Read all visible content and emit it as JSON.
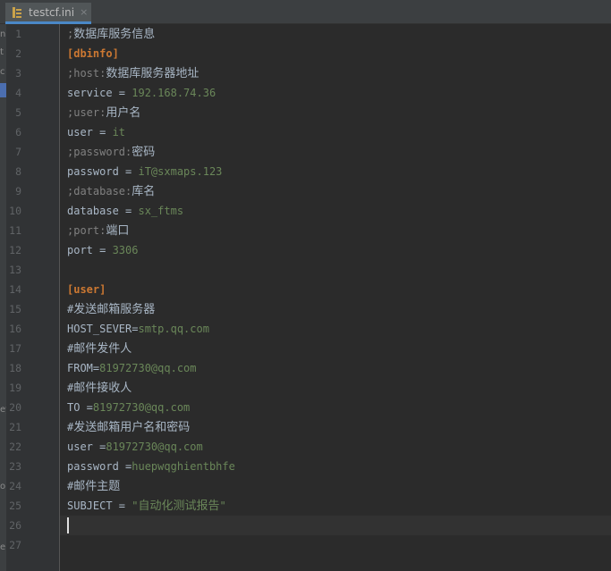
{
  "tab": {
    "filename": "testcf.ini",
    "close_glyph": "×",
    "icon": "ini-file-icon"
  },
  "left_strip": {
    "marks": [
      "n",
      "t",
      "c",
      "ey",
      "o",
      "e"
    ]
  },
  "lines": [
    {
      "num": "1",
      "comment_prefix": ";",
      "comment_zh": "数据库服务信息"
    },
    {
      "num": "2",
      "header": "[dbinfo]"
    },
    {
      "num": "3",
      "comment_prefix": ";host:",
      "comment_zh": "数据库服务器地址"
    },
    {
      "num": "4",
      "key": "service = ",
      "value": "192.168.74.36"
    },
    {
      "num": "5",
      "comment_prefix": ";user:",
      "comment_zh": "用户名"
    },
    {
      "num": "6",
      "key": "user = ",
      "value": "it"
    },
    {
      "num": "7",
      "comment_prefix": ";password:",
      "comment_zh": "密码"
    },
    {
      "num": "8",
      "key": "password = ",
      "value": "iT@sxmaps.123"
    },
    {
      "num": "9",
      "comment_prefix": ";database:",
      "comment_zh": "库名"
    },
    {
      "num": "10",
      "key": "database = ",
      "value": "sx_ftms"
    },
    {
      "num": "11",
      "comment_prefix": ";port:",
      "comment_zh": "端口"
    },
    {
      "num": "12",
      "key": "port = ",
      "value": "3306"
    },
    {
      "num": "13"
    },
    {
      "num": "14",
      "header": "[user]"
    },
    {
      "num": "15",
      "hash": "#",
      "hash_zh": "发送邮箱服务器"
    },
    {
      "num": "16",
      "key": "HOST_SEVER=",
      "value": "smtp.qq.com"
    },
    {
      "num": "17",
      "hash": "#",
      "hash_zh": "邮件发件人"
    },
    {
      "num": "18",
      "key": "FROM=",
      "value": "81972730@qq.com"
    },
    {
      "num": "19",
      "hash": "#",
      "hash_zh": "邮件接收人"
    },
    {
      "num": "20",
      "key": "TO =",
      "value": "81972730@qq.com"
    },
    {
      "num": "21",
      "hash": "#",
      "hash_zh": "发送邮箱用户名和密码"
    },
    {
      "num": "22",
      "key": "user =",
      "value": "81972730@qq.com"
    },
    {
      "num": "23",
      "key": "password =",
      "value": "huepwqghientbhfe"
    },
    {
      "num": "24",
      "hash": "#",
      "hash_zh": "邮件主题"
    },
    {
      "num": "25",
      "key": "SUBJECT = ",
      "value_q1": "\"",
      "value_zh": "自动化测试报告",
      "value_q2": "\""
    },
    {
      "num": "26",
      "current": true
    },
    {
      "num": "27"
    }
  ],
  "colors": {
    "background": "#2b2b2b",
    "gutter": "#313335",
    "key": "#a9b7c6",
    "value": "#6a8759",
    "comment": "#808080",
    "section_header": "#cc7832",
    "line_number": "#606366",
    "tab_accent": "#4a88c7"
  }
}
